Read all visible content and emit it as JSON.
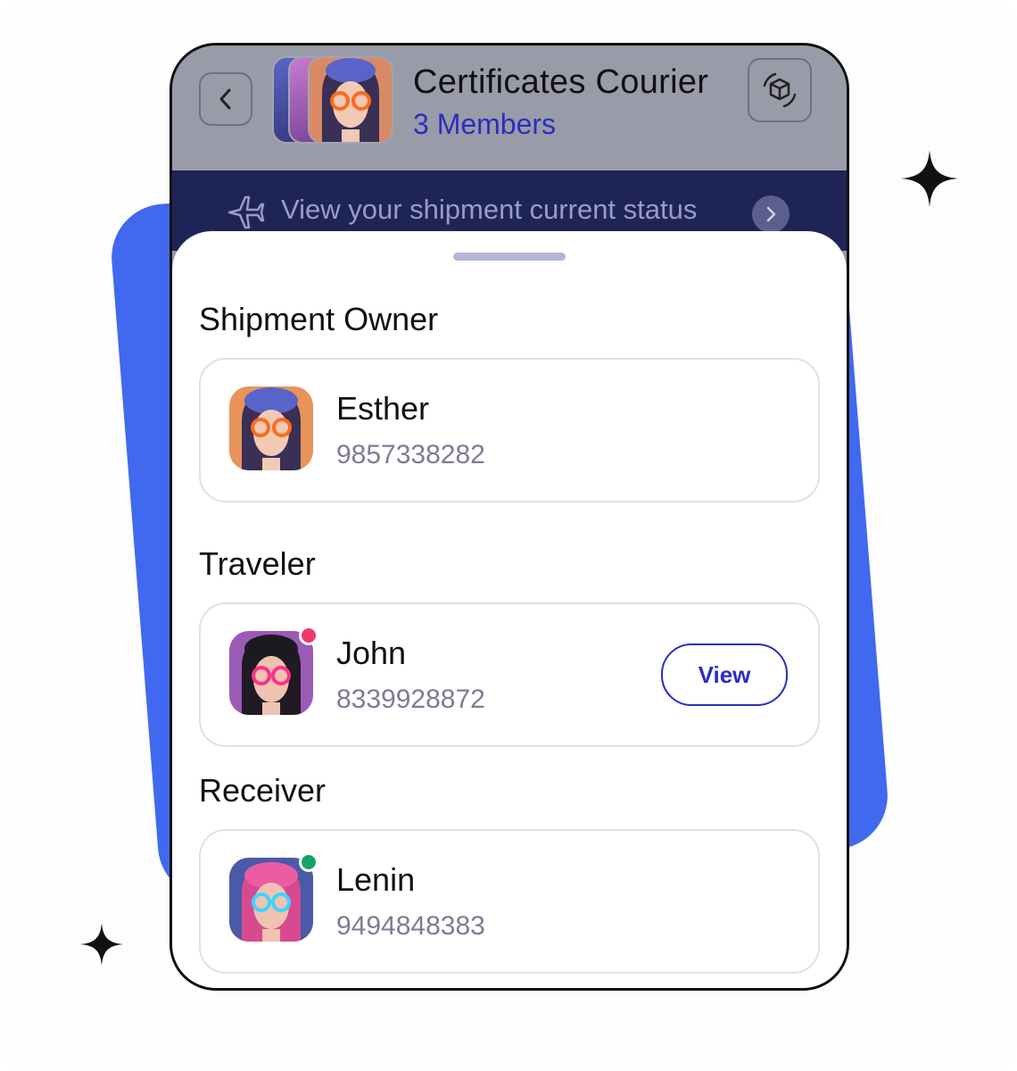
{
  "header": {
    "title": "Certificates Courier",
    "subtitle": "3 Members",
    "back_icon": "chevron-left-icon",
    "box_icon": "box-sync-icon"
  },
  "status_banner": {
    "text": "View your shipment current status",
    "icon": "airplane-icon",
    "chevron_icon": "chevron-right-icon"
  },
  "sections": {
    "owner": {
      "title": "Shipment Owner",
      "name": "Esther",
      "phone": "9857338282"
    },
    "traveler": {
      "title": "Traveler",
      "name": "John",
      "phone": "8339928872",
      "action_label": "View",
      "status_color": "#f0386b"
    },
    "receiver": {
      "title": "Receiver",
      "name": "Lenin",
      "phone": "9494848383",
      "status_color": "#14a36a"
    }
  },
  "colors": {
    "accent": "#2b2ec0",
    "banner": "#1f2456",
    "backdrop_card": "#4169ef"
  }
}
